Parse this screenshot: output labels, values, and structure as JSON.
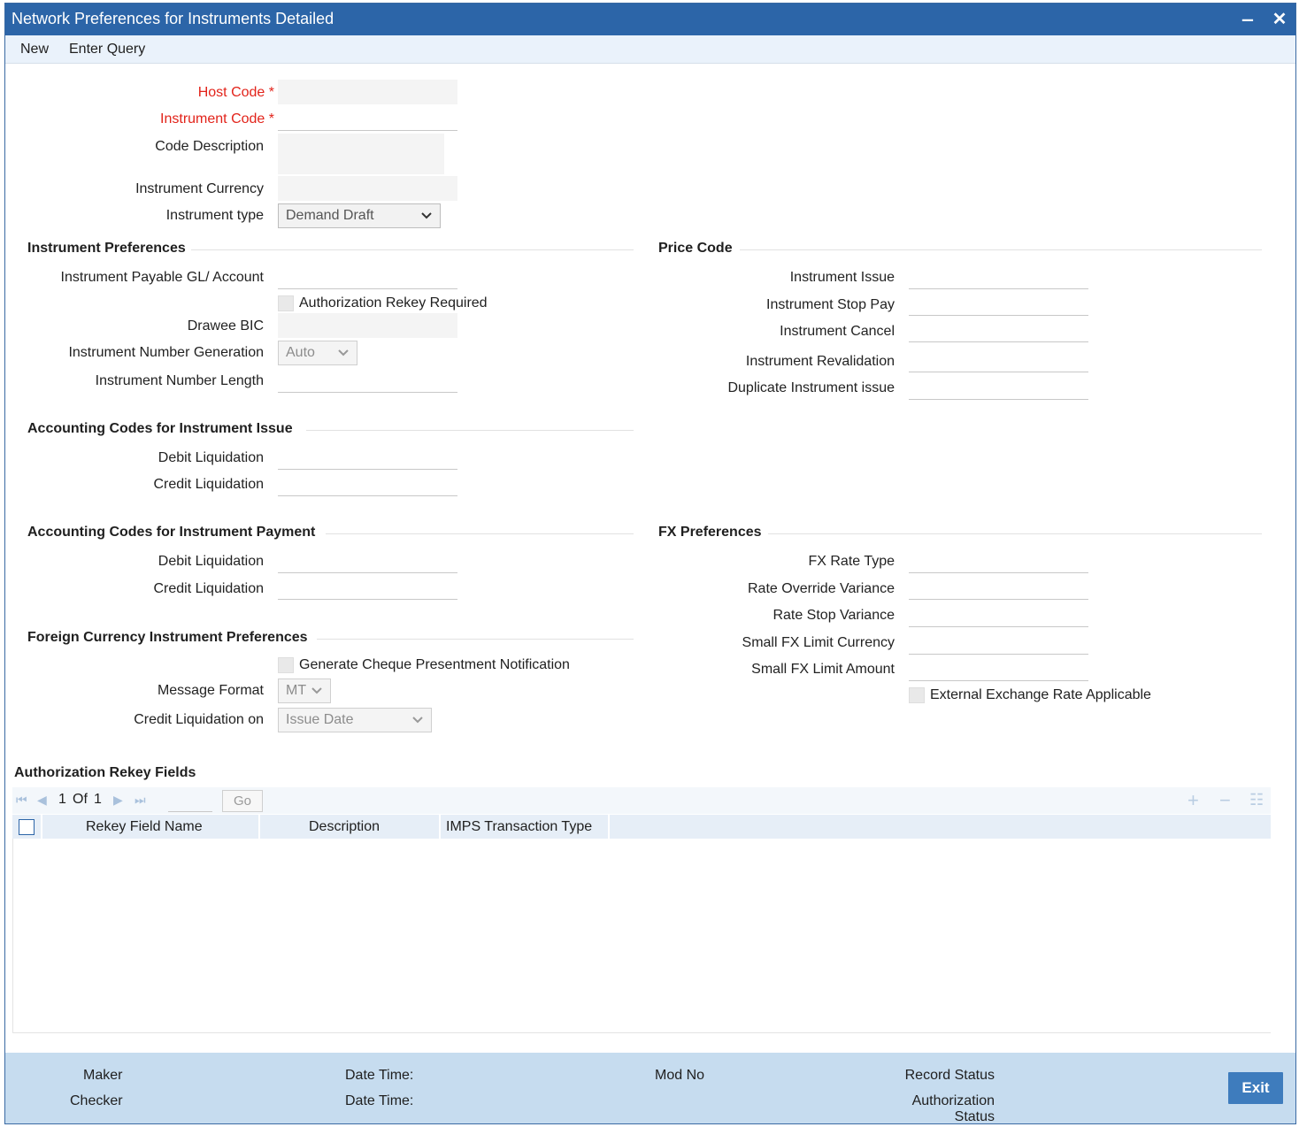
{
  "window": {
    "title": "Network Preferences for Instruments Detailed",
    "minimize_glyph": "‒",
    "close_glyph": "✕"
  },
  "menu": {
    "items": [
      "New",
      "Enter Query"
    ]
  },
  "header_fields": {
    "host_code": {
      "label": "Host Code",
      "required_mark": "*",
      "value": ""
    },
    "instrument_code": {
      "label": "Instrument Code",
      "required_mark": "*",
      "value": ""
    },
    "code_description": {
      "label": "Code Description",
      "value": ""
    },
    "instrument_currency": {
      "label": "Instrument Currency",
      "value": ""
    },
    "instrument_type": {
      "label": "Instrument type",
      "selected": "Demand Draft"
    }
  },
  "instrument_preferences": {
    "title": "Instrument Preferences",
    "payable_gl": {
      "label": "Instrument Payable GL/ Account",
      "value": ""
    },
    "auth_rekey": {
      "label": "Authorization Rekey Required",
      "checked": false
    },
    "drawee_bic": {
      "label": "Drawee BIC",
      "value": ""
    },
    "number_generation": {
      "label": "Instrument Number Generation",
      "selected": "Auto"
    },
    "number_length": {
      "label": "Instrument Number Length",
      "value": ""
    }
  },
  "price_code": {
    "title": "Price Code",
    "instrument_issue": {
      "label": "Instrument Issue",
      "value": ""
    },
    "instrument_stop_pay": {
      "label": "Instrument Stop Pay",
      "value": ""
    },
    "instrument_cancel": {
      "label": "Instrument Cancel",
      "value": ""
    },
    "instrument_revalidation": {
      "label": "Instrument Revalidation",
      "value": ""
    },
    "duplicate_issue": {
      "label": "Duplicate Instrument issue",
      "value": ""
    }
  },
  "acct_issue": {
    "title": "Accounting Codes for Instrument Issue",
    "debit": {
      "label": "Debit Liquidation",
      "value": ""
    },
    "credit": {
      "label": "Credit Liquidation",
      "value": ""
    }
  },
  "acct_payment": {
    "title": "Accounting Codes for Instrument Payment",
    "debit": {
      "label": "Debit Liquidation",
      "value": ""
    },
    "credit": {
      "label": "Credit Liquidation",
      "value": ""
    }
  },
  "fx_preferences": {
    "title": "FX Preferences",
    "rate_type": {
      "label": "FX Rate Type",
      "value": ""
    },
    "override_variance": {
      "label": "Rate Override Variance",
      "value": ""
    },
    "stop_variance": {
      "label": "Rate Stop Variance",
      "value": ""
    },
    "small_limit_ccy": {
      "label": "Small FX Limit Currency",
      "value": ""
    },
    "small_limit_amt": {
      "label": "Small FX Limit Amount",
      "value": ""
    },
    "external_rate": {
      "label": "External Exchange Rate Applicable",
      "checked": false
    }
  },
  "foreign_ccy_prefs": {
    "title": "Foreign Currency Instrument Preferences",
    "cheque_notification": {
      "label": "Generate Cheque Presentment Notification",
      "checked": false
    },
    "message_format": {
      "label": "Message Format",
      "selected": "MT"
    },
    "credit_liq_on": {
      "label": "Credit Liquidation on",
      "selected": "Issue Date"
    }
  },
  "rekey_grid": {
    "title": "Authorization Rekey Fields",
    "pagination": {
      "current": "1",
      "of_label": "Of",
      "total": "1",
      "page_input": "",
      "go_label": "Go"
    },
    "columns": [
      "Rekey Field Name",
      "Description",
      "IMPS Transaction Type"
    ],
    "rows": []
  },
  "footer": {
    "maker_label": "Maker",
    "checker_label": "Checker",
    "date_time_label_1": "Date Time:",
    "date_time_label_2": "Date Time:",
    "mod_no_label": "Mod No",
    "record_status_label": "Record Status",
    "auth_status_label_line1": "Authorization",
    "auth_status_label_line2": "Status",
    "exit_label": "Exit"
  },
  "colors": {
    "title_bar": "#2c65a8",
    "required": "#e2231a",
    "footer_bg": "#c6dcef",
    "exit_button": "#3e7cbd"
  }
}
